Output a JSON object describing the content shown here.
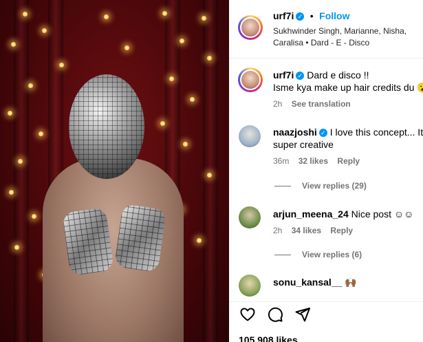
{
  "post": {
    "username": "urf7i",
    "separator": "•",
    "follow_label": "Follow",
    "audio_line_1": "Sukhwinder Singh, Marianne, Nisha,",
    "audio_line_2": "Caralisa • Dard - E - Disco"
  },
  "caption": {
    "username": "urf7i",
    "text_line_1": "Dard e disco !!",
    "text_line_2": "Isme kya make up hair credits du 😮",
    "time": "2h",
    "see_translation": "See translation"
  },
  "comments": [
    {
      "username": "naazjoshi",
      "verified": true,
      "text_line_1": "I love this concept... It's",
      "text_line_2": "super creative",
      "time": "36m",
      "likes": "32 likes",
      "reply": "Reply",
      "view_replies": "View replies (29)"
    },
    {
      "username": "arjun_meena_24",
      "verified": false,
      "text_line_1": "Nice post ☺☺",
      "time": "2h",
      "likes": "34 likes",
      "reply": "Reply",
      "view_replies": "View replies (6)"
    },
    {
      "username": "sonu_kansal__",
      "verified": false,
      "text_line_1": "🙌🏾"
    }
  ],
  "likes_count": "105,908 likes",
  "colors": {
    "follow": "#0095f6",
    "verified": "#0095f6",
    "muted": "#737373"
  },
  "icons": [
    "verified-badge-icon",
    "heart-icon",
    "comment-icon",
    "share-icon"
  ]
}
